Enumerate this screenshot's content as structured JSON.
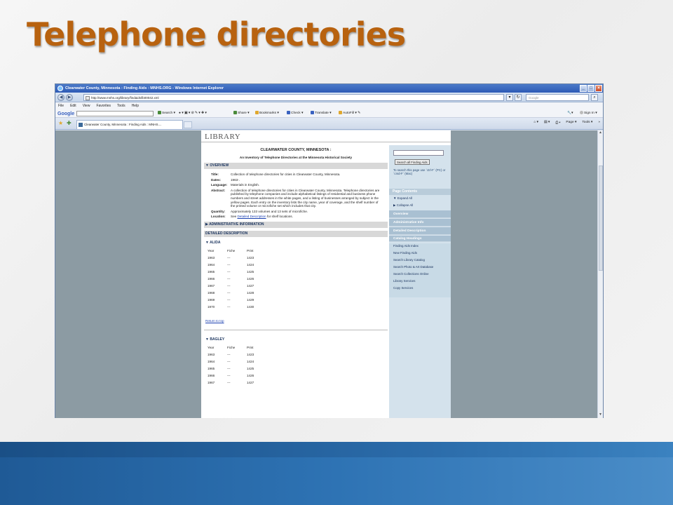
{
  "slide": {
    "title": "Telephone directories"
  },
  "browser": {
    "window_title": "Clearwater County, Minnesota : Finding Aids : MNHS.ORG - Windows Internet Explorer",
    "url": "http://www.mnhs.org/library/findaids/lb00042.xml",
    "search_placeholder": "Google",
    "menu": [
      "File",
      "Edit",
      "View",
      "Favorites",
      "Tools",
      "Help"
    ],
    "google_toolbar": {
      "logo": "Google",
      "search": "Search",
      "share": "Share",
      "bookmarks": "Bookmarks",
      "check": "Check",
      "translate": "Translate",
      "autofill": "AutoFill",
      "sign_in": "Sign In"
    },
    "tab_title": "Clearwater County, Minnesota : Finding Aids : MNHS....",
    "command_bar": [
      "Page",
      "Tools"
    ]
  },
  "page": {
    "header": "LIBRARY",
    "doc_title": "CLEARWATER COUNTY, MINNESOTA :",
    "doc_subtitle": "An Inventory of Telephone Directories at the Minnesota Historical Society",
    "overview_label": "OVERVIEW",
    "overview": {
      "title_key": "Title:",
      "title_val": "Collection of telephone directories for cities in Clearwater County, Minnesota.",
      "dates_key": "Dates:",
      "dates_val": "1963-.",
      "language_key": "Language:",
      "language_val": "Materials in English.",
      "abstract_key": "Abstract:",
      "abstract_val": "A collection of telephone directories for cities in Clearwater County, Minnesota. Telephone directories are published by telephone companies and include alphabetical listings of residential and business phone numbers and street addresses in the white pages, and a listing of businesses arranged by subject in the yellow pages. Each entry on the inventory lists the city name, year of coverage, and the shelf number of the printed volume or microfiche set which includes that city.",
      "quantity_key": "Quantity:",
      "quantity_val": "Approximately 133 volumes and 13 sets of microfiche.",
      "location_key": "Location:",
      "location_pre": "See",
      "location_link": "Detailed Description",
      "location_post": "for shelf locations."
    },
    "admin_label": "ADMINISTRATIVE INFORMATION",
    "detailed_label": "DETAILED DESCRIPTION",
    "return_link": "Return to top",
    "columns": [
      "Year",
      "Fiche",
      "Print"
    ],
    "places": [
      {
        "name": "ALIDA",
        "rows": [
          [
            "1963",
            "---",
            "1423"
          ],
          [
            "1964",
            "---",
            "1424"
          ],
          [
            "1965",
            "---",
            "1425"
          ],
          [
            "1966",
            "---",
            "1426"
          ],
          [
            "1967",
            "---",
            "1427"
          ],
          [
            "1968",
            "---",
            "1428"
          ],
          [
            "1969",
            "---",
            "1429"
          ],
          [
            "1970",
            "---",
            "1430"
          ]
        ]
      },
      {
        "name": "BAGLEY",
        "rows": [
          [
            "1963",
            "---",
            "1423"
          ],
          [
            "1964",
            "---",
            "1424"
          ],
          [
            "1965",
            "---",
            "1425"
          ],
          [
            "1966",
            "---",
            "1426"
          ],
          [
            "1967",
            "---",
            "1427"
          ]
        ]
      }
    ],
    "sidebar": {
      "search_button": "Search all Finding Aids",
      "hint": "To search this page use `ctrl-F` (PC) or `cmd-F` (Mac)",
      "contents_head": "Page Contents",
      "expand": "Expand All",
      "collapse": "Collapse All",
      "blocks": [
        "Overview",
        "Administrative Info",
        "Detailed Description",
        "Catalog Headings"
      ],
      "links": [
        "Finding Aids Index",
        "New Finding Aids",
        "Search Library Catalog",
        "Search Photo & Art Database",
        "Search Collections Online",
        "Library Services",
        "Copy Services"
      ]
    }
  }
}
